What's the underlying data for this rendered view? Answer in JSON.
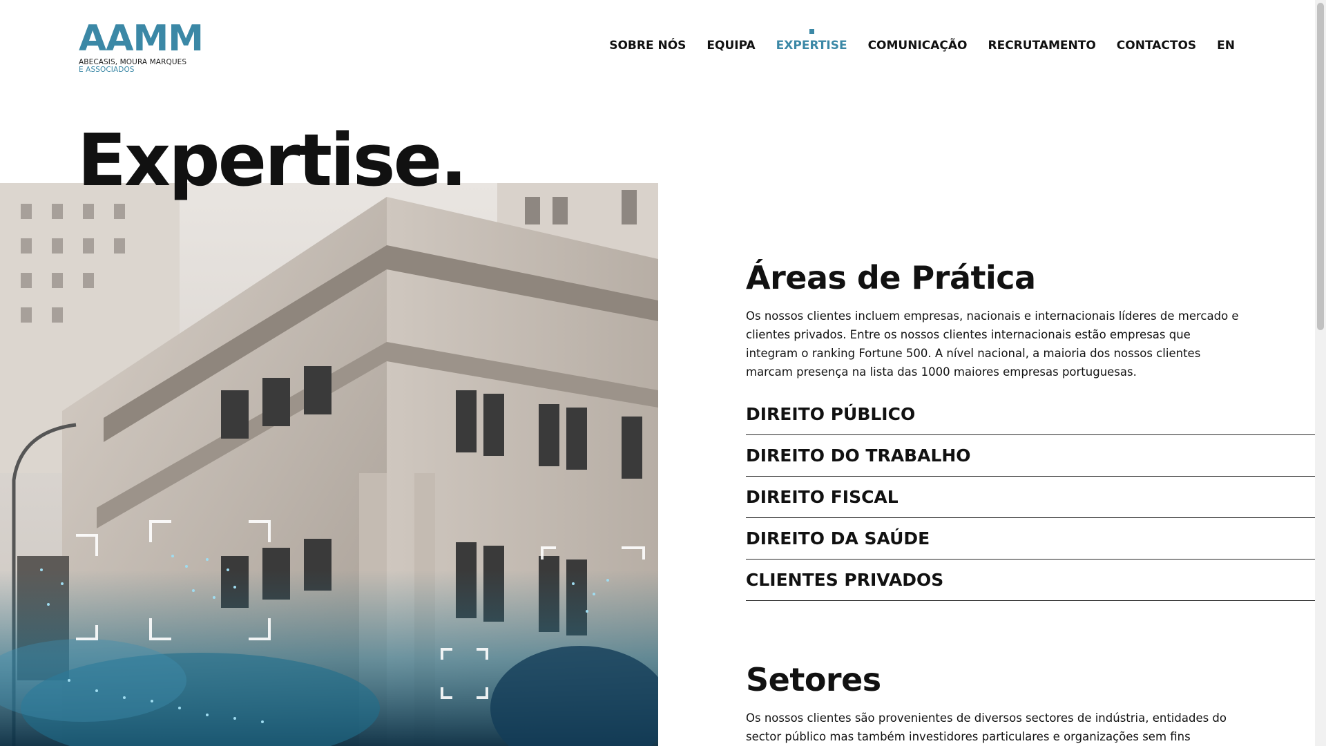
{
  "brand": {
    "mark": "AAMM",
    "line1": "ABECASIS, MOURA MARQUES",
    "line2": "E ASSOCIADOS",
    "accent_color": "#3b88a6"
  },
  "nav": {
    "items": [
      {
        "label": "SOBRE NÓS",
        "active": false
      },
      {
        "label": "EQUIPA",
        "active": false
      },
      {
        "label": "EXPERTISE",
        "active": true
      },
      {
        "label": "COMUNICAÇÃO",
        "active": false
      },
      {
        "label": "RECRUTAMENTO",
        "active": false
      },
      {
        "label": "CONTACTOS",
        "active": false
      },
      {
        "label": "EN",
        "active": false
      }
    ]
  },
  "page": {
    "title": "Expertise."
  },
  "hero": {
    "image": "building-city-street-photo"
  },
  "practice_areas": {
    "title": "Áreas de Prática",
    "description": "Os nossos clientes incluem empresas, nacionais e internacionais líderes de mercado e clientes privados. Entre os nossos clientes internacionais estão empresas que integram o ranking Fortune 500. A nível nacional, a maioria dos nossos clientes marcam presença na lista das 1000 maiores empresas portuguesas.",
    "items": [
      "DIREITO PÚBLICO",
      "DIREITO DO TRABALHO",
      "DIREITO FISCAL",
      "DIREITO DA SAÚDE",
      "CLIENTES PRIVADOS"
    ]
  },
  "sectors": {
    "title": "Setores",
    "description": "Os nossos clientes são provenientes de diversos sectores de indústria, entidades do sector público mas também investidores particulares e organizações sem fins lucrativos."
  }
}
